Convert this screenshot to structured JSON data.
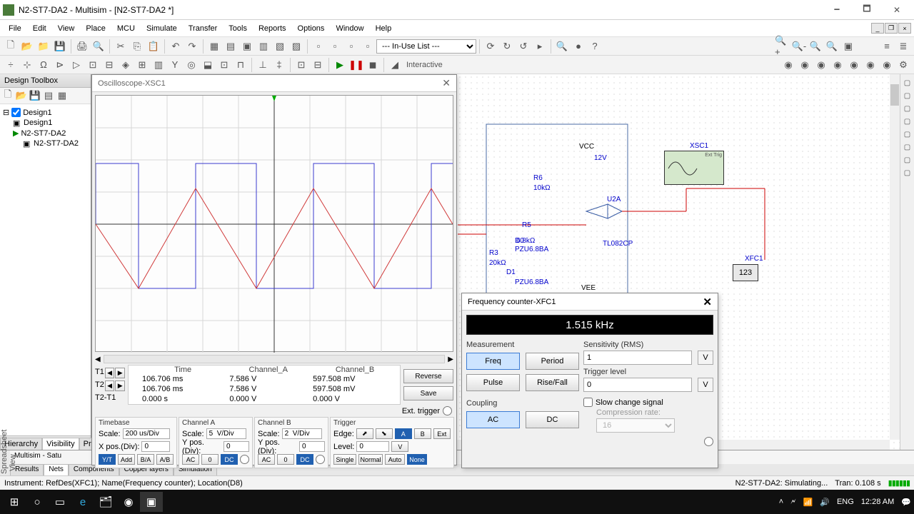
{
  "window": {
    "title": "N2-ST7-DA2 - Multisim - [N2-ST7-DA2 *]"
  },
  "menu": [
    "File",
    "Edit",
    "View",
    "Place",
    "MCU",
    "Simulate",
    "Transfer",
    "Tools",
    "Reports",
    "Options",
    "Window",
    "Help"
  ],
  "in_use_list": "--- In-Use List ---",
  "interactive_label": "Interactive",
  "designToolbox": {
    "title": "Design Toolbox",
    "tree": {
      "root": "Design1",
      "items": [
        "Design1",
        "N2-ST7-DA2",
        "N2-ST7-DA2"
      ]
    },
    "tabs": [
      "Hierarchy",
      "Visibility",
      "Proj"
    ]
  },
  "schematic": {
    "vcc": {
      "label": "VCC",
      "value": "12V"
    },
    "r6": {
      "label": "R6",
      "value": "10kΩ"
    },
    "r5": {
      "label": "R5",
      "value": "6.8kΩ"
    },
    "r3": {
      "label": "R3",
      "value": "20kΩ"
    },
    "d0": {
      "label": "D0",
      "part": "PZU6.8BA"
    },
    "d1": {
      "label": "D1",
      "part": "PZU6.8BA"
    },
    "u2a": {
      "label": "U2A",
      "part": "TL082CP"
    },
    "xsc1": {
      "label": "XSC1",
      "exttrig": "Ext Trig"
    },
    "xfc1": {
      "label": "XFC1",
      "display": "123"
    },
    "vee": {
      "label": "VEE"
    }
  },
  "osc": {
    "title": "Oscilloscope-XSC1",
    "cursors": {
      "t1": "T1",
      "t2": "T2",
      "dt": "T2-T1"
    },
    "table": {
      "headers": [
        "",
        "Time",
        "Channel_A",
        "Channel_B"
      ],
      "rows": [
        [
          "T1",
          "106.706 ms",
          "7.586 V",
          "597.508 mV"
        ],
        [
          "T2",
          "106.706 ms",
          "7.586 V",
          "597.508 mV"
        ],
        [
          "T2-T1",
          "0.000 s",
          "0.000 V",
          "0.000 V"
        ]
      ]
    },
    "buttons": {
      "reverse": "Reverse",
      "save": "Save"
    },
    "ext_trigger": "Ext. trigger",
    "timebase": {
      "title": "Timebase",
      "scale_label": "Scale:",
      "scale": "200 us/Div",
      "xpos_label": "X pos.(Div):",
      "xpos": "0",
      "btns": [
        "Y/T",
        "Add",
        "B/A",
        "A/B"
      ]
    },
    "chanA": {
      "title": "Channel A",
      "scale_label": "Scale:",
      "scale": "5  V/Div",
      "ypos_label": "Y pos.(Div):",
      "ypos": "0",
      "btns": [
        "AC",
        "0",
        "DC"
      ]
    },
    "chanB": {
      "title": "Channel B",
      "scale_label": "Scale:",
      "scale": "2  V/Div",
      "ypos_label": "Y pos.(Div):",
      "ypos": "0",
      "btns": [
        "AC",
        "0",
        "DC"
      ]
    },
    "trigger": {
      "title": "Trigger",
      "edge_label": "Edge:",
      "level_label": "Level:",
      "level": "0",
      "unit": "V",
      "btns": [
        "Single",
        "Normal",
        "Auto",
        "None"
      ],
      "srcs": [
        "A",
        "B",
        "Ext"
      ]
    }
  },
  "fc": {
    "title": "Frequency counter-XFC1",
    "display": "1.515 kHz",
    "measurement": {
      "label": "Measurement",
      "btns": [
        "Freq",
        "Period",
        "Pulse",
        "Rise/Fall"
      ]
    },
    "coupling": {
      "label": "Coupling",
      "btns": [
        "AC",
        "DC"
      ]
    },
    "sensitivity": {
      "label": "Sensitivity (RMS)",
      "value": "1",
      "unit": "V"
    },
    "trigger": {
      "label": "Trigger level",
      "value": "0",
      "unit": "V"
    },
    "slow": {
      "label": "Slow change signal",
      "compression": "Compression rate:",
      "rate": "16"
    }
  },
  "bottom": {
    "text": "Multisim  -  Satu",
    "tabs": [
      "Results",
      "Nets",
      "Components",
      "Copper layers",
      "Simulation"
    ]
  },
  "sidelabel": "Spreadsheet View",
  "status": {
    "left": "Instrument: RefDes(XFC1); Name(Frequency counter); Location(D8)",
    "sim": "N2-ST7-DA2: Simulating...",
    "tran": "Tran: 0.108 s"
  },
  "taskbar": {
    "lang": "ENG",
    "time": "12:28 AM"
  }
}
